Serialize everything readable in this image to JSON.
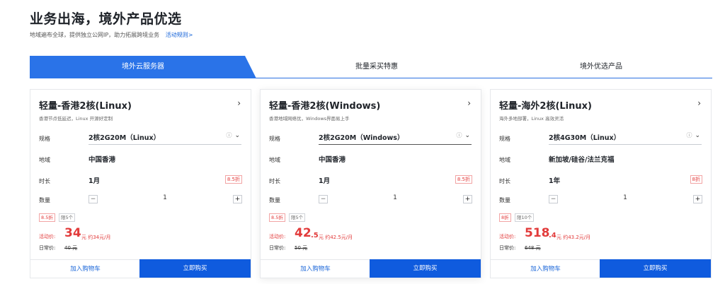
{
  "section": {
    "title": "业务出海，境外产品优选",
    "subtitle": "地域遍布全球，提供独立公网IP，助力拓展跨境业务",
    "rule_link": "活动规则>"
  },
  "tabs": [
    {
      "label": "境外云服务器",
      "active": true
    },
    {
      "label": "批量采买特惠",
      "active": false
    },
    {
      "label": "境外优选产品",
      "active": false
    }
  ],
  "labels": {
    "spec": "规格",
    "region": "地域",
    "duration": "时长",
    "quantity": "数量",
    "promo_price": "活动价:",
    "original_price": "日常价:",
    "add_to_cart": "加入购物车",
    "buy_now": "立即购买",
    "arrow": "›",
    "minus": "−",
    "plus": "+",
    "info_icon": "ⓘ",
    "chevron": "⌄"
  },
  "cards": [
    {
      "title": "轻量-香港2核(Linux)",
      "desc": "香港节点低延迟，Linux 开源好定制",
      "spec": "2核2G20M（Linux）",
      "region": "中国香港",
      "duration": "1月",
      "duration_discount": "8.5折",
      "quantity": "1",
      "discount_badge": "8.5折",
      "limit_badge": "限5个",
      "price_int": "34",
      "price_unit": "元 约34元/月",
      "orig_price": "40 元"
    },
    {
      "title": "轻量-香港2核(Windows)",
      "desc": "香港地域网络优，Windows界面易上手",
      "spec": "2核2G20M（Windows）",
      "region": "中国香港",
      "duration": "1月",
      "duration_discount": "8.5折",
      "quantity": "1",
      "discount_badge": "8.5折",
      "limit_badge": "限5个",
      "price_int": "42",
      "price_dec": ".5",
      "price_unit": "元 约42.5元/月",
      "orig_price": "50 元"
    },
    {
      "title": "轻量-海外2核(Linux)",
      "desc": "海外多地部署，Linux 高效灵活",
      "spec": "2核4G30M（Linux）",
      "region": "新加坡/硅谷/法兰克福",
      "duration": "1年",
      "duration_discount": "8折",
      "quantity": "1",
      "discount_badge": "8折",
      "limit_badge": "限10个",
      "price_int": "518",
      "price_dec": ".4",
      "price_unit": "元 约43.2元/月",
      "orig_price": "648 元"
    }
  ],
  "colors": {
    "accent": "#0f5bde",
    "tab_active": "#2a73e8",
    "price_red": "#e23b3b"
  }
}
